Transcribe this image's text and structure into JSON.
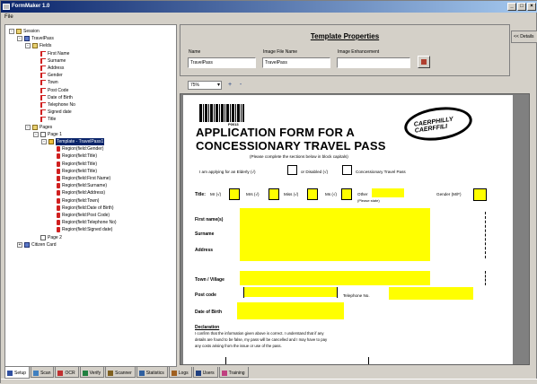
{
  "window": {
    "title": "FormMaker 1.0"
  },
  "menubar": {
    "file": "File"
  },
  "side_button": "<< Details",
  "tree": {
    "root": "Session",
    "form": "TravelPass",
    "fields_folder": "Fields",
    "fields": [
      "First Name",
      "Surname",
      "Address",
      "Gender",
      "Town",
      "Post Code",
      "Date of Birth",
      "Telephone No",
      "Signed date",
      "Title"
    ],
    "pages_folder": "Pages",
    "page1": "Page 1",
    "template": "Template - TravelPass1",
    "regions": [
      "Region(field:Gender)",
      "Region(field:Title)",
      "Region(field:Title)",
      "Region(field:Title)",
      "Region(field:First Name)",
      "Region(field:Surname)",
      "Region(field:Address)",
      "Region(field:Town)",
      "Region(field:Date of Birth)",
      "Region(field:Post Code)",
      "Region(field:Telephone No)",
      "Region(field:Signed date)"
    ],
    "page2": "Page 2",
    "citizen": "Citizen Card"
  },
  "properties": {
    "title": "Template Properties",
    "name_label": "Name",
    "name_value": "TravelPass",
    "filename_label": "Image File Name",
    "filename_value": "TravelPass",
    "enhance_label": "Image Enhancement",
    "enhance_value": ""
  },
  "toolbar": {
    "zoom": "75%",
    "zoom_in": "+",
    "zoom_out": "-"
  },
  "document": {
    "barcode_caption": "P0013",
    "logo_text_1": "CAERPHILLY",
    "logo_text_2": "CAERFFILI",
    "heading_1": "APPLICATION FORM FOR A",
    "heading_2": "CONCESSIONARY TRAVEL PASS",
    "instruction": "(Please complete the sections below in block capitals)",
    "applying": "I am applying for an Elderly (√)",
    "disabled": "or Disabled (√)",
    "concessionary": "Concessionary Travel Pass",
    "title_label": "Title:",
    "mr": "Mr (√)",
    "mrs": "Mrs (√)",
    "miss": "Miss (√)",
    "ms": "Ms (√)",
    "other": "Other",
    "please_state": "(Please state)",
    "gender": "Gender (M/F)",
    "first_name": "First name(s)",
    "surname": "Surname",
    "address": "Address",
    "town": "Town / Village",
    "postcode": "Post code",
    "telephone": "Telephone No.",
    "dob": "Date of Birth",
    "declaration_title": "Declaration",
    "declaration_1": "I confirm that the information given above is correct. I understand that if any",
    "declaration_2": "details are found to be false, my pass will be cancelled and I may have to pay",
    "declaration_3": "any costs arising from the issue or use of the pass."
  },
  "bottom_tabs": [
    "Setup",
    "Scan",
    "OCR",
    "Verify",
    "Scanner",
    "Statistics",
    "Logs",
    "Users",
    "Training"
  ],
  "colors": {
    "highlight": "#ffff00",
    "selection": "#0a246a"
  }
}
